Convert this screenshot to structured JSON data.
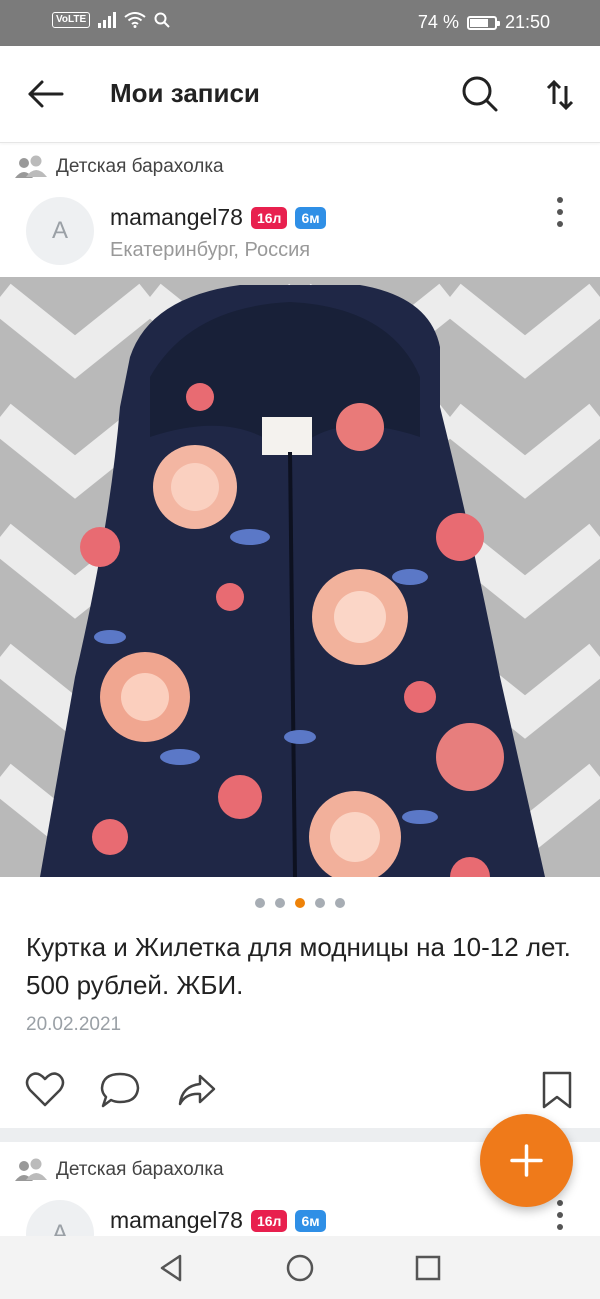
{
  "status_bar": {
    "network": "VoLTE",
    "battery": "74 %",
    "battery_level": 0.74,
    "time": "21:50"
  },
  "app_bar": {
    "title": "Мои записи",
    "back_icon": "arrow-left-icon",
    "search_icon": "search-icon",
    "sort_icon": "sort-arrows-icon"
  },
  "posts": [
    {
      "group": "Детская барахолка",
      "avatar_letter": "A",
      "author": "mamangel78",
      "age_badge": "16л",
      "time_badge": "6м",
      "location": "Екатеринбург, Россия",
      "photo_dots": 5,
      "active_photo": 3,
      "text": "Куртка и Жилетка для модницы на 10-12 лет. 500 рублей. ЖБИ.",
      "date": "20.02.2021"
    },
    {
      "group": "Детская барахолка",
      "avatar_letter": "A",
      "author": "mamangel78",
      "age_badge": "16л",
      "time_badge": "6м"
    }
  ],
  "colors": {
    "accent": "#ef7a1a",
    "age_badge": "#e8204e",
    "time_badge": "#2f8fe6",
    "status_bar": "#7b7b7b"
  }
}
